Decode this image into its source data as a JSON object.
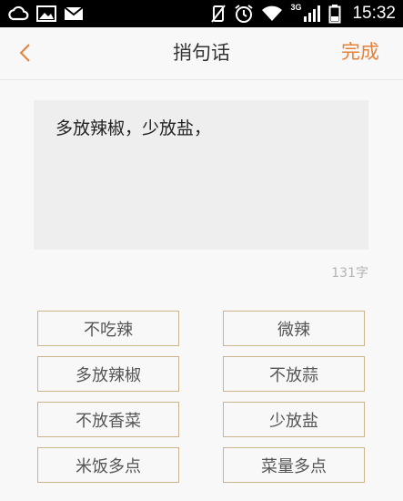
{
  "status_bar": {
    "time": "15:32",
    "network": "3G",
    "icons": [
      "cloud-icon",
      "image-icon",
      "mail-icon",
      "vibrate-off-icon",
      "alarm-icon",
      "wifi-icon",
      "signal-icon",
      "battery-icon"
    ]
  },
  "header": {
    "title": "捎句话",
    "done_label": "完成",
    "back_icon": "chevron-left-icon"
  },
  "note": {
    "text": "多放辣椒，少放盐，",
    "char_count": "131字"
  },
  "tags": [
    {
      "label": "不吃辣"
    },
    {
      "label": "微辣"
    },
    {
      "label": "多放辣椒"
    },
    {
      "label": "不放蒜"
    },
    {
      "label": "不放香菜"
    },
    {
      "label": "少放盐"
    },
    {
      "label": "米饭多点"
    },
    {
      "label": "菜量多点"
    }
  ],
  "colors": {
    "accent": "#e4823c",
    "tag_border": "#c9b48e",
    "background": "#f8f8f8",
    "input_background": "#eeeeee"
  }
}
